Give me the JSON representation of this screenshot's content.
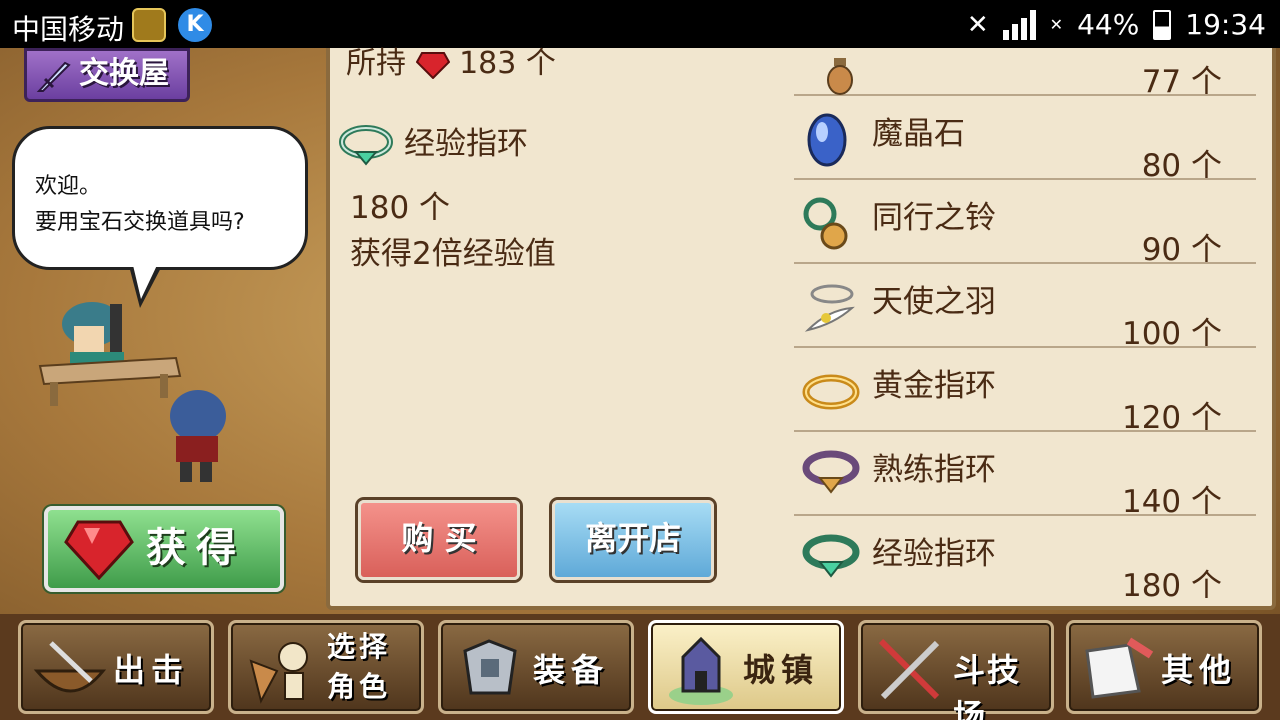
{
  "status_bar": {
    "carrier": "中国移动",
    "battery": "44%",
    "time": "19:34"
  },
  "shop": {
    "sign": "交换屋",
    "bubble_line1": "欢迎。",
    "bubble_line2": "要用宝石交换道具吗?",
    "get_button": "获得"
  },
  "detail": {
    "owned": "所持",
    "owned_count": "183 个",
    "item_name": "经验指环",
    "price": "180 个",
    "description": "获得2倍经验值",
    "buy_button": "购 买",
    "leave_button": "离开店"
  },
  "items": [
    {
      "name": "",
      "price": "77 个",
      "icon": "potion-icon"
    },
    {
      "name": "魔晶石",
      "price": "80 个",
      "icon": "magic-crystal-icon"
    },
    {
      "name": "同行之铃",
      "price": "90 个",
      "icon": "bell-icon"
    },
    {
      "name": "天使之羽",
      "price": "100 个",
      "icon": "feather-icon"
    },
    {
      "name": "黄金指环",
      "price": "120 个",
      "icon": "gold-ring-icon"
    },
    {
      "name": "熟练指环",
      "price": "140 个",
      "icon": "skill-ring-icon"
    },
    {
      "name": "经验指环",
      "price": "180 个",
      "icon": "exp-ring-icon"
    }
  ],
  "toolbar": {
    "sortie": "出击",
    "select_char_1": "选择",
    "select_char_2": "角色",
    "equip": "装备",
    "town": "城镇",
    "arena": "斗技场",
    "other": "其他"
  }
}
